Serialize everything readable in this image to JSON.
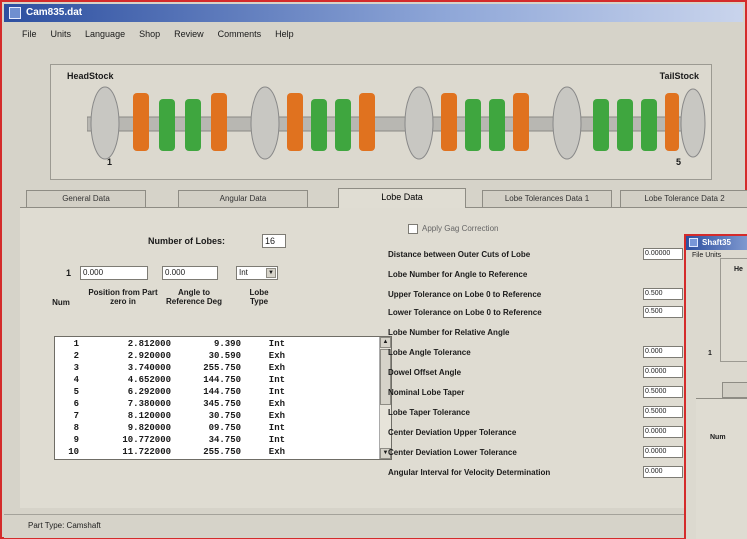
{
  "window": {
    "title": "Cam835.dat"
  },
  "menu": [
    "File",
    "Units",
    "Language",
    "Shop",
    "Review",
    "Comments",
    "Help"
  ],
  "shaft": {
    "headstock": "HeadStock",
    "tailstock": "TailStock",
    "left_index": "1",
    "right_index": "5"
  },
  "tabs": [
    {
      "label": "General Data",
      "active": false
    },
    {
      "label": "Angular Data",
      "active": false
    },
    {
      "label": "Lobe Data",
      "active": true
    },
    {
      "label": "Lobe Tolerances Data 1",
      "active": false
    },
    {
      "label": "Lobe Tolerance Data 2",
      "active": false
    }
  ],
  "lobes": {
    "number_label": "Number of Lobes:",
    "number_value": "16",
    "entry": {
      "num": "1",
      "position": "0.000",
      "angle": "0.000",
      "type": "Int"
    },
    "headers": {
      "num": "Num",
      "position": "Position from Part zero in",
      "angle": "Angle to Reference Deg",
      "type": "Lobe Type"
    },
    "rows": [
      {
        "num": "1",
        "pos": "2.812000",
        "ang": "9.390",
        "type": "Int"
      },
      {
        "num": "2",
        "pos": "2.920000",
        "ang": "30.590",
        "type": "Exh"
      },
      {
        "num": "3",
        "pos": "3.740000",
        "ang": "255.750",
        "type": "Exh"
      },
      {
        "num": "4",
        "pos": "4.652000",
        "ang": "144.750",
        "type": "Int"
      },
      {
        "num": "5",
        "pos": "6.292000",
        "ang": "144.750",
        "type": "Int"
      },
      {
        "num": "6",
        "pos": "7.380000",
        "ang": "345.750",
        "type": "Exh"
      },
      {
        "num": "7",
        "pos": "8.120000",
        "ang": "30.750",
        "type": "Exh"
      },
      {
        "num": "8",
        "pos": "9.820000",
        "ang": "09.750",
        "type": "Int"
      },
      {
        "num": "9",
        "pos": "10.772000",
        "ang": "34.750",
        "type": "Int"
      },
      {
        "num": "10",
        "pos": "11.722000",
        "ang": "255.750",
        "type": "Exh"
      }
    ]
  },
  "right": {
    "apply_gag": "Apply Gag Correction",
    "fields": [
      {
        "label": "Distance between Outer Cuts of Lobe",
        "value": "0.00000"
      },
      {
        "label": "Lobe Number for Angle to Reference",
        "value": ""
      },
      {
        "label": "Upper Tolerance on Lobe 0 to Reference",
        "value": "0.500"
      },
      {
        "label": "Lower Tolerance on Lobe 0 to Reference",
        "value": "0.500"
      },
      {
        "label": "Lobe Number for Relative Angle",
        "value": ""
      },
      {
        "label": "Lobe Angle Tolerance",
        "value": "0.000"
      },
      {
        "label": "Dowel Offset Angle",
        "value": "0.0000"
      },
      {
        "label": "Nominal Lobe Taper",
        "value": "0.5000"
      },
      {
        "label": "Lobe Taper Tolerance",
        "value": "0.5000"
      },
      {
        "label": "Center Deviation Upper Tolerance",
        "value": "0.0000"
      },
      {
        "label": "Center Deviation Lower Tolerance",
        "value": "0.0000"
      },
      {
        "label": "Angular Interval for Velocity Determination",
        "value": "0.000"
      }
    ]
  },
  "status": {
    "text": "Part Type: Camshaft"
  },
  "second_window": {
    "title": "Shaft35",
    "menu": "File Units",
    "headstock": "He",
    "index": "1",
    "label": "Num"
  }
}
